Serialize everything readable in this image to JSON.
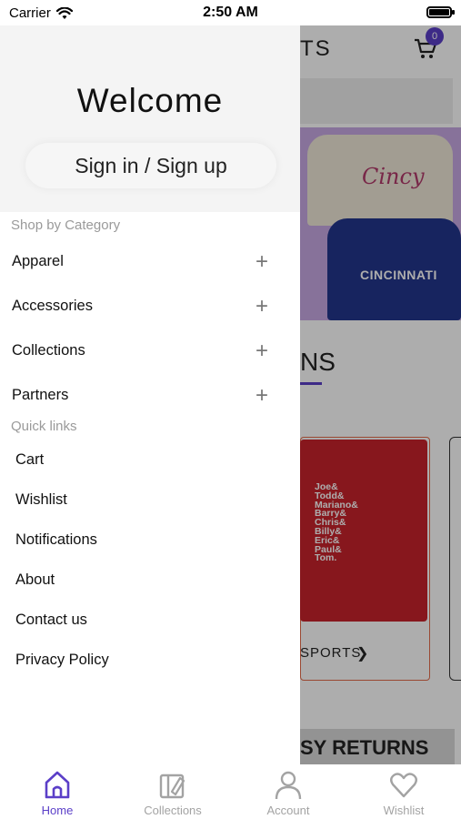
{
  "status_bar": {
    "carrier": "Carrier",
    "time": "2:50 AM"
  },
  "background": {
    "title_fragment": "TS",
    "cart_count": "0",
    "banner_shirt_1": "Cincy",
    "banner_shirt_2": "CINCINNATI",
    "section_heading_fragment": "NS",
    "product_shirt_text": "Joe&\nTodd&\nMariano&\nBarry&\nChris&\nBilly&\nEric&\nPaul&\nTom.",
    "product_category_fragment": "SPORTS",
    "returns_fragment": "SY RETURNS"
  },
  "drawer": {
    "welcome": "Welcome",
    "sign_in_label": "Sign in / Sign up",
    "shop_by_category_label": "Shop by Category",
    "categories": [
      {
        "label": "Apparel"
      },
      {
        "label": "Accessories"
      },
      {
        "label": "Collections"
      },
      {
        "label": "Partners"
      }
    ],
    "quick_links_label": "Quick links",
    "quick_links": [
      {
        "label": "Cart"
      },
      {
        "label": "Wishlist"
      },
      {
        "label": "Notifications"
      },
      {
        "label": "About"
      },
      {
        "label": "Contact us"
      },
      {
        "label": "Privacy Policy"
      }
    ]
  },
  "tabbar": {
    "active_color": "#5b3fc8",
    "inactive_color": "#a3a3a3",
    "tabs": [
      {
        "label": "Home",
        "icon": "home-icon"
      },
      {
        "label": "Collections",
        "icon": "collections-icon"
      },
      {
        "label": "Account",
        "icon": "account-icon"
      },
      {
        "label": "Wishlist",
        "icon": "heart-icon"
      }
    ]
  }
}
